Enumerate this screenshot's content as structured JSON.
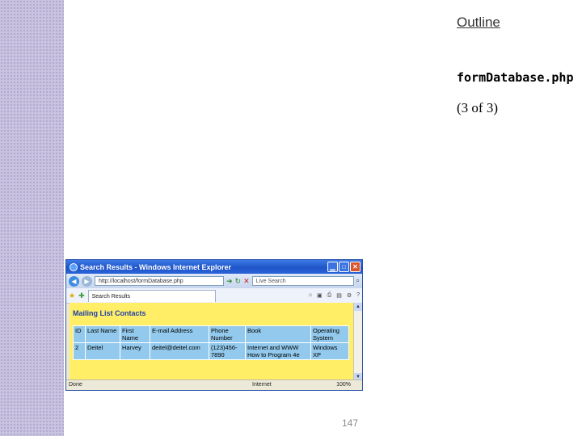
{
  "slide": {
    "outline_label": "Outline",
    "file_name": "formDatabase.php",
    "page_indicator": "(3 of 3)",
    "slide_number": "147"
  },
  "browser": {
    "title": "Search Results - Windows Internet Explorer",
    "address": "http://localhost/formDatabase.php",
    "search_placeholder": "Live Search",
    "tab_label": "Search Results",
    "status_left": "Done",
    "status_zone": "Internet",
    "status_zoom": "100%"
  },
  "page": {
    "heading": "Mailing List Contacts",
    "table": {
      "headers": [
        "ID",
        "Last Name",
        "First Name",
        "E-mail Address",
        "Phone Number",
        "Book",
        "Operating System"
      ],
      "rows": [
        [
          "2",
          "Deitel",
          "Harvey",
          "deitel@deitel.com",
          "(123)456-7890",
          "Internet and WWW How to Program 4e",
          "Windows XP"
        ]
      ]
    }
  },
  "colors": {
    "content_bg": "#ffee66",
    "heading_text": "#1f3ea8",
    "table_cell": "#92c9ec",
    "left_band": "#c9c3e0"
  }
}
